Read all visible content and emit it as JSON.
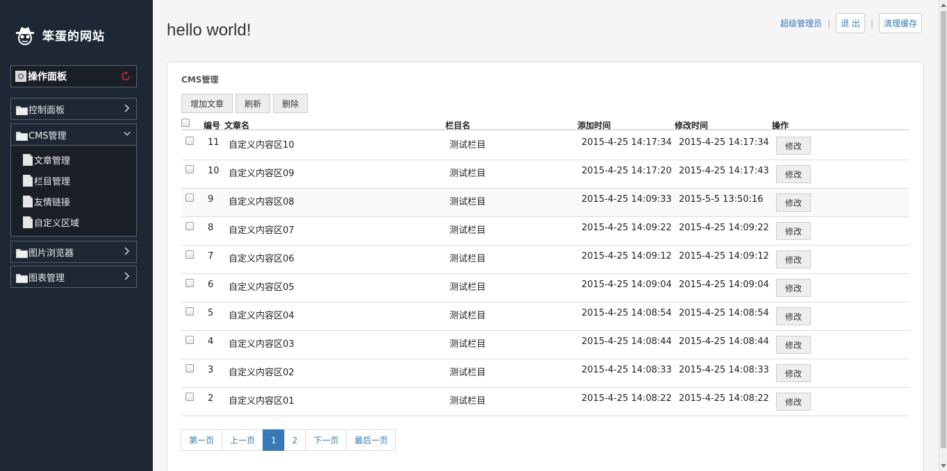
{
  "site": {
    "name": "笨蛋的网站",
    "panel_title": "操作面板"
  },
  "sidebar": {
    "items": [
      {
        "label": "控制面板"
      },
      {
        "label": "CMS管理"
      },
      {
        "label": "图片浏览器"
      },
      {
        "label": "图表管理"
      }
    ],
    "sub_items": [
      {
        "label": "文章管理"
      },
      {
        "label": "栏目管理"
      },
      {
        "label": "友情链接"
      },
      {
        "label": "自定义区域"
      }
    ]
  },
  "header": {
    "title": "hello world!",
    "user_link": "超级管理员",
    "logout": "退 出",
    "clear_cache": "清理缓存"
  },
  "card": {
    "title": "CMS管理"
  },
  "toolbar": {
    "add": "增加文章",
    "refresh": "刷新",
    "delete": "删除"
  },
  "table": {
    "headers": {
      "id": "编号",
      "name": "文章名",
      "column": "栏目名",
      "added": "添加时间",
      "modified": "修改时间",
      "action": "操作"
    },
    "edit_label": "修改",
    "rows": [
      {
        "id": "11",
        "name": "自定义内容区10",
        "column": "测试栏目",
        "added": "2015-4-25 14:17:34",
        "modified": "2015-4-25 14:17:34"
      },
      {
        "id": "10",
        "name": "自定义内容区09",
        "column": "测试栏目",
        "added": "2015-4-25 14:17:20",
        "modified": "2015-4-25 14:17:43"
      },
      {
        "id": "9",
        "name": "自定义内容区08",
        "column": "测试栏目",
        "added": "2015-4-25 14:09:33",
        "modified": "2015-5-5 13:50:16"
      },
      {
        "id": "8",
        "name": "自定义内容区07",
        "column": "测试栏目",
        "added": "2015-4-25 14:09:22",
        "modified": "2015-4-25 14:09:22"
      },
      {
        "id": "7",
        "name": "自定义内容区06",
        "column": "测试栏目",
        "added": "2015-4-25 14:09:12",
        "modified": "2015-4-25 14:09:12"
      },
      {
        "id": "6",
        "name": "自定义内容区05",
        "column": "测试栏目",
        "added": "2015-4-25 14:09:04",
        "modified": "2015-4-25 14:09:04"
      },
      {
        "id": "5",
        "name": "自定义内容区04",
        "column": "测试栏目",
        "added": "2015-4-25 14:08:54",
        "modified": "2015-4-25 14:08:54"
      },
      {
        "id": "4",
        "name": "自定义内容区03",
        "column": "测试栏目",
        "added": "2015-4-25 14:08:44",
        "modified": "2015-4-25 14:08:44"
      },
      {
        "id": "3",
        "name": "自定义内容区02",
        "column": "测试栏目",
        "added": "2015-4-25 14:08:33",
        "modified": "2015-4-25 14:08:33"
      },
      {
        "id": "2",
        "name": "自定义内容区01",
        "column": "测试栏目",
        "added": "2015-4-25 14:08:22",
        "modified": "2015-4-25 14:08:22"
      }
    ]
  },
  "pagination": {
    "first": "第一页",
    "prev": "上一页",
    "pages": [
      "1",
      "2"
    ],
    "current": "1",
    "next": "下一页",
    "last": "最后一页"
  },
  "colors": {
    "sidebar_bg": "#1e2834",
    "link": "#337ab7",
    "active_page": "#337ab7"
  }
}
